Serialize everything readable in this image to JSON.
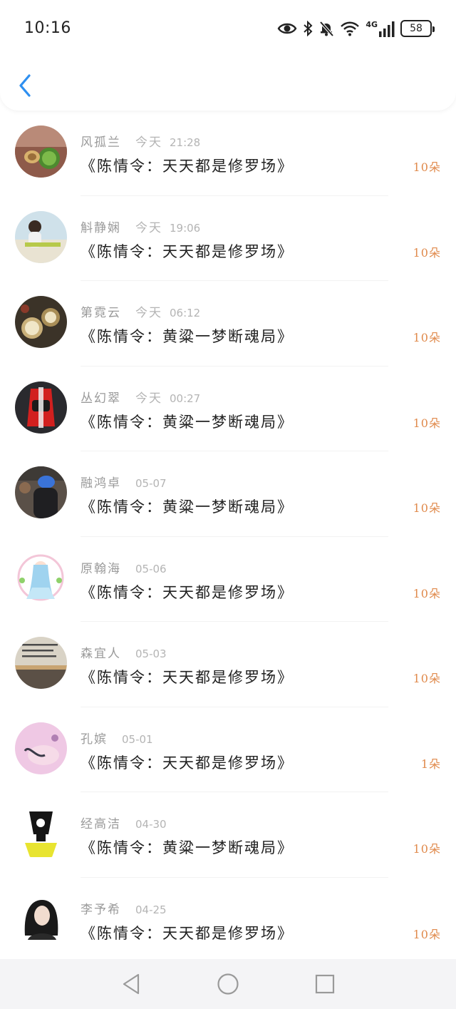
{
  "status_bar": {
    "time": "10:16",
    "network_label": "4G",
    "battery_level": "58",
    "icons": [
      "eye-icon",
      "bluetooth-icon",
      "bell-muted-icon",
      "wifi-icon",
      "signal-icon",
      "battery-icon"
    ]
  },
  "header": {
    "back_icon": "chevron-left-icon",
    "accent_color": "#2e8ff0"
  },
  "colors": {
    "sender_name": "#9a9a9a",
    "title_text": "#222222",
    "gift_count": "#e08a4c"
  },
  "gift_list": [
    {
      "sender": "风孤兰",
      "day": "今天",
      "time": "21:28",
      "title": "《陈情令：天天都是修罗场》",
      "count": "10朵",
      "avatar": "avatar-fruit"
    },
    {
      "sender": "斛静娴",
      "day": "今天",
      "time": "19:06",
      "title": "《陈情令：天天都是修罗场》",
      "count": "10朵",
      "avatar": "avatar-beach-boy"
    },
    {
      "sender": "第霓云",
      "day": "今天",
      "time": "06:12",
      "title": "《陈情令：黄粱一梦断魂局》",
      "count": "10朵",
      "avatar": "avatar-clock"
    },
    {
      "sender": "丛幻翠",
      "day": "今天",
      "time": "00:27",
      "title": "《陈情令：黄粱一梦断魂局》",
      "count": "10朵",
      "avatar": "avatar-red-car"
    },
    {
      "sender": "融鸿卓",
      "day": "",
      "time": "05-07",
      "title": "《陈情令：黄粱一梦断魂局》",
      "count": "10朵",
      "avatar": "avatar-blue-cap"
    },
    {
      "sender": "原翰海",
      "day": "",
      "time": "05-06",
      "title": "《陈情令：天天都是修罗场》",
      "count": "10朵",
      "avatar": "avatar-anime-girl"
    },
    {
      "sender": "森宜人",
      "day": "",
      "time": "05-03",
      "title": "《陈情令：天天都是修罗场》",
      "count": "10朵",
      "avatar": "avatar-sunset-text"
    },
    {
      "sender": "孔嫔",
      "day": "",
      "time": "05-01",
      "title": "《陈情令：天天都是修罗场》",
      "count": "1朵",
      "avatar": "avatar-pink-hand"
    },
    {
      "sender": "经高洁",
      "day": "",
      "time": "04-30",
      "title": "《陈情令：黄粱一梦断魂局》",
      "count": "10朵",
      "avatar": "avatar-cartoon"
    },
    {
      "sender": "李予希",
      "day": "",
      "time": "04-25",
      "title": "《陈情令：天天都是修罗场》",
      "count": "10朵",
      "avatar": "avatar-dark-hair-girl"
    }
  ],
  "nav_bar": {
    "buttons": [
      "back-triangle-icon",
      "home-circle-icon",
      "recents-square-icon"
    ]
  }
}
